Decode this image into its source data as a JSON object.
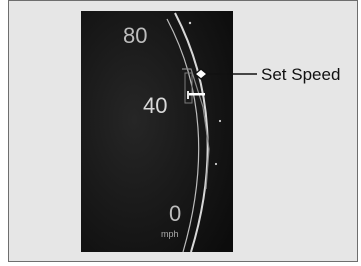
{
  "gauge": {
    "labels": [
      "80",
      "40",
      "0"
    ],
    "unit": "mph"
  },
  "callout": {
    "label": "Set Speed"
  },
  "colors": {
    "panel_bg": "#e6e6e6",
    "panel_border": "#6e6e6e",
    "gauge_bg": "#1a1a1a",
    "gauge_numbers": "#b9b9b9",
    "needle_white": "#ffffff"
  }
}
